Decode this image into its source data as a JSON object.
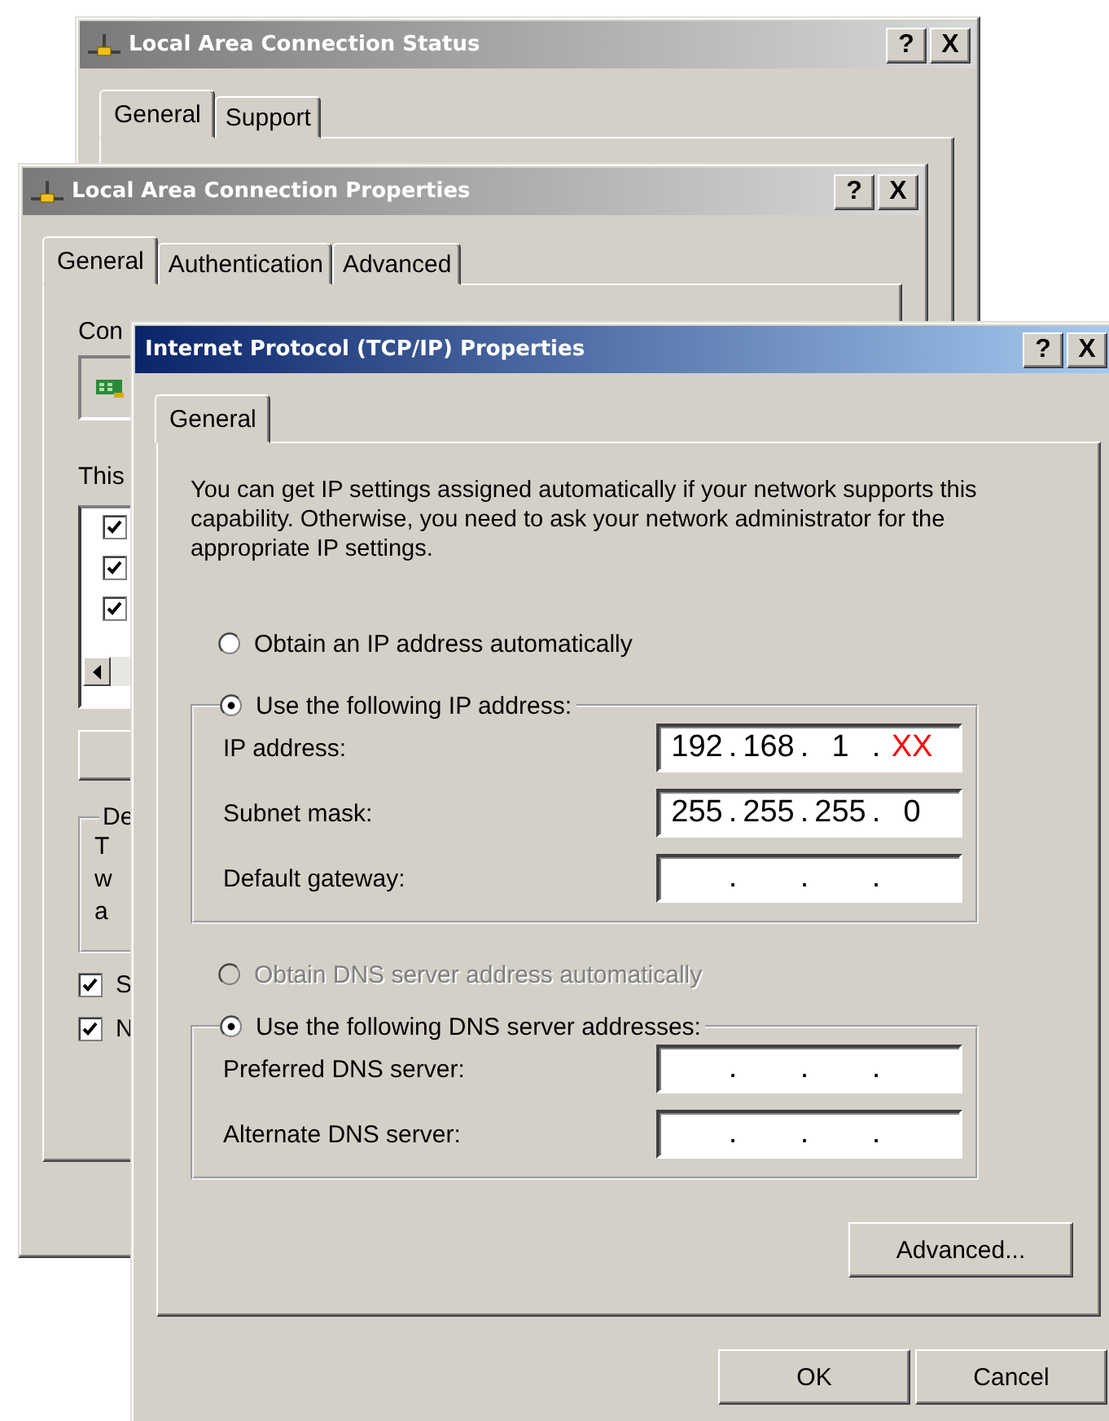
{
  "status_window": {
    "title": "Local Area Connection Status",
    "active": false,
    "title_buttons": [
      "?",
      "X"
    ],
    "tabs": [
      {
        "label": "General",
        "selected": true
      },
      {
        "label": "Support",
        "selected": false
      }
    ]
  },
  "properties_window": {
    "title": "Local Area Connection Properties",
    "active": false,
    "title_buttons": [
      "?",
      "X"
    ],
    "tabs": [
      {
        "label": "General",
        "selected": true
      },
      {
        "label": "Authentication",
        "selected": false
      },
      {
        "label": "Advanced",
        "selected": false
      }
    ],
    "connect_label": "Con",
    "items_label": "This",
    "items": [
      {
        "checked": true
      },
      {
        "checked": true
      },
      {
        "checked": true
      }
    ],
    "group_label": "De",
    "group_lines": [
      "T",
      "w",
      "a"
    ],
    "options": [
      {
        "label": "S",
        "checked": true
      },
      {
        "label": "N",
        "checked": true
      }
    ]
  },
  "tcpip_window": {
    "title": "Internet Protocol (TCP/IP) Properties",
    "active": true,
    "title_buttons": [
      "?",
      "X"
    ],
    "tabs": [
      {
        "label": "General",
        "selected": true
      }
    ],
    "description": "You can get IP settings assigned automatically if your network supports this capability. Otherwise, you need to ask your network administrator for the appropriate IP settings.",
    "ip_auto": {
      "label": "Obtain an IP address automatically",
      "selected": false,
      "disabled": false
    },
    "ip_manual": {
      "label": "Use the following IP address:",
      "selected": true,
      "disabled": false
    },
    "ip_fields": [
      {
        "label": "IP address:",
        "separator": ".",
        "octets": [
          {
            "text": "192",
            "highlighted": false
          },
          {
            "text": "168",
            "highlighted": false
          },
          {
            "text": "1",
            "highlighted": false
          },
          {
            "text": "XX",
            "highlighted": true
          }
        ]
      },
      {
        "label": "Subnet mask:",
        "separator": ".",
        "octets": [
          {
            "text": "255",
            "highlighted": false
          },
          {
            "text": "255",
            "highlighted": false
          },
          {
            "text": "255",
            "highlighted": false
          },
          {
            "text": "0",
            "highlighted": false
          }
        ]
      },
      {
        "label": "Default gateway:",
        "separator": "."
      }
    ],
    "dns_auto": {
      "label": "Obtain DNS server address automatically",
      "selected": false,
      "disabled": true
    },
    "dns_manual": {
      "label": "Use the following DNS server addresses:",
      "selected": true,
      "disabled": false
    },
    "dns_fields": [
      {
        "label": "Preferred DNS server:",
        "separator": "."
      },
      {
        "label": "Alternate DNS server:",
        "separator": "."
      }
    ],
    "advanced_button": "Advanced...",
    "buttons": [
      "OK",
      "Cancel"
    ]
  }
}
